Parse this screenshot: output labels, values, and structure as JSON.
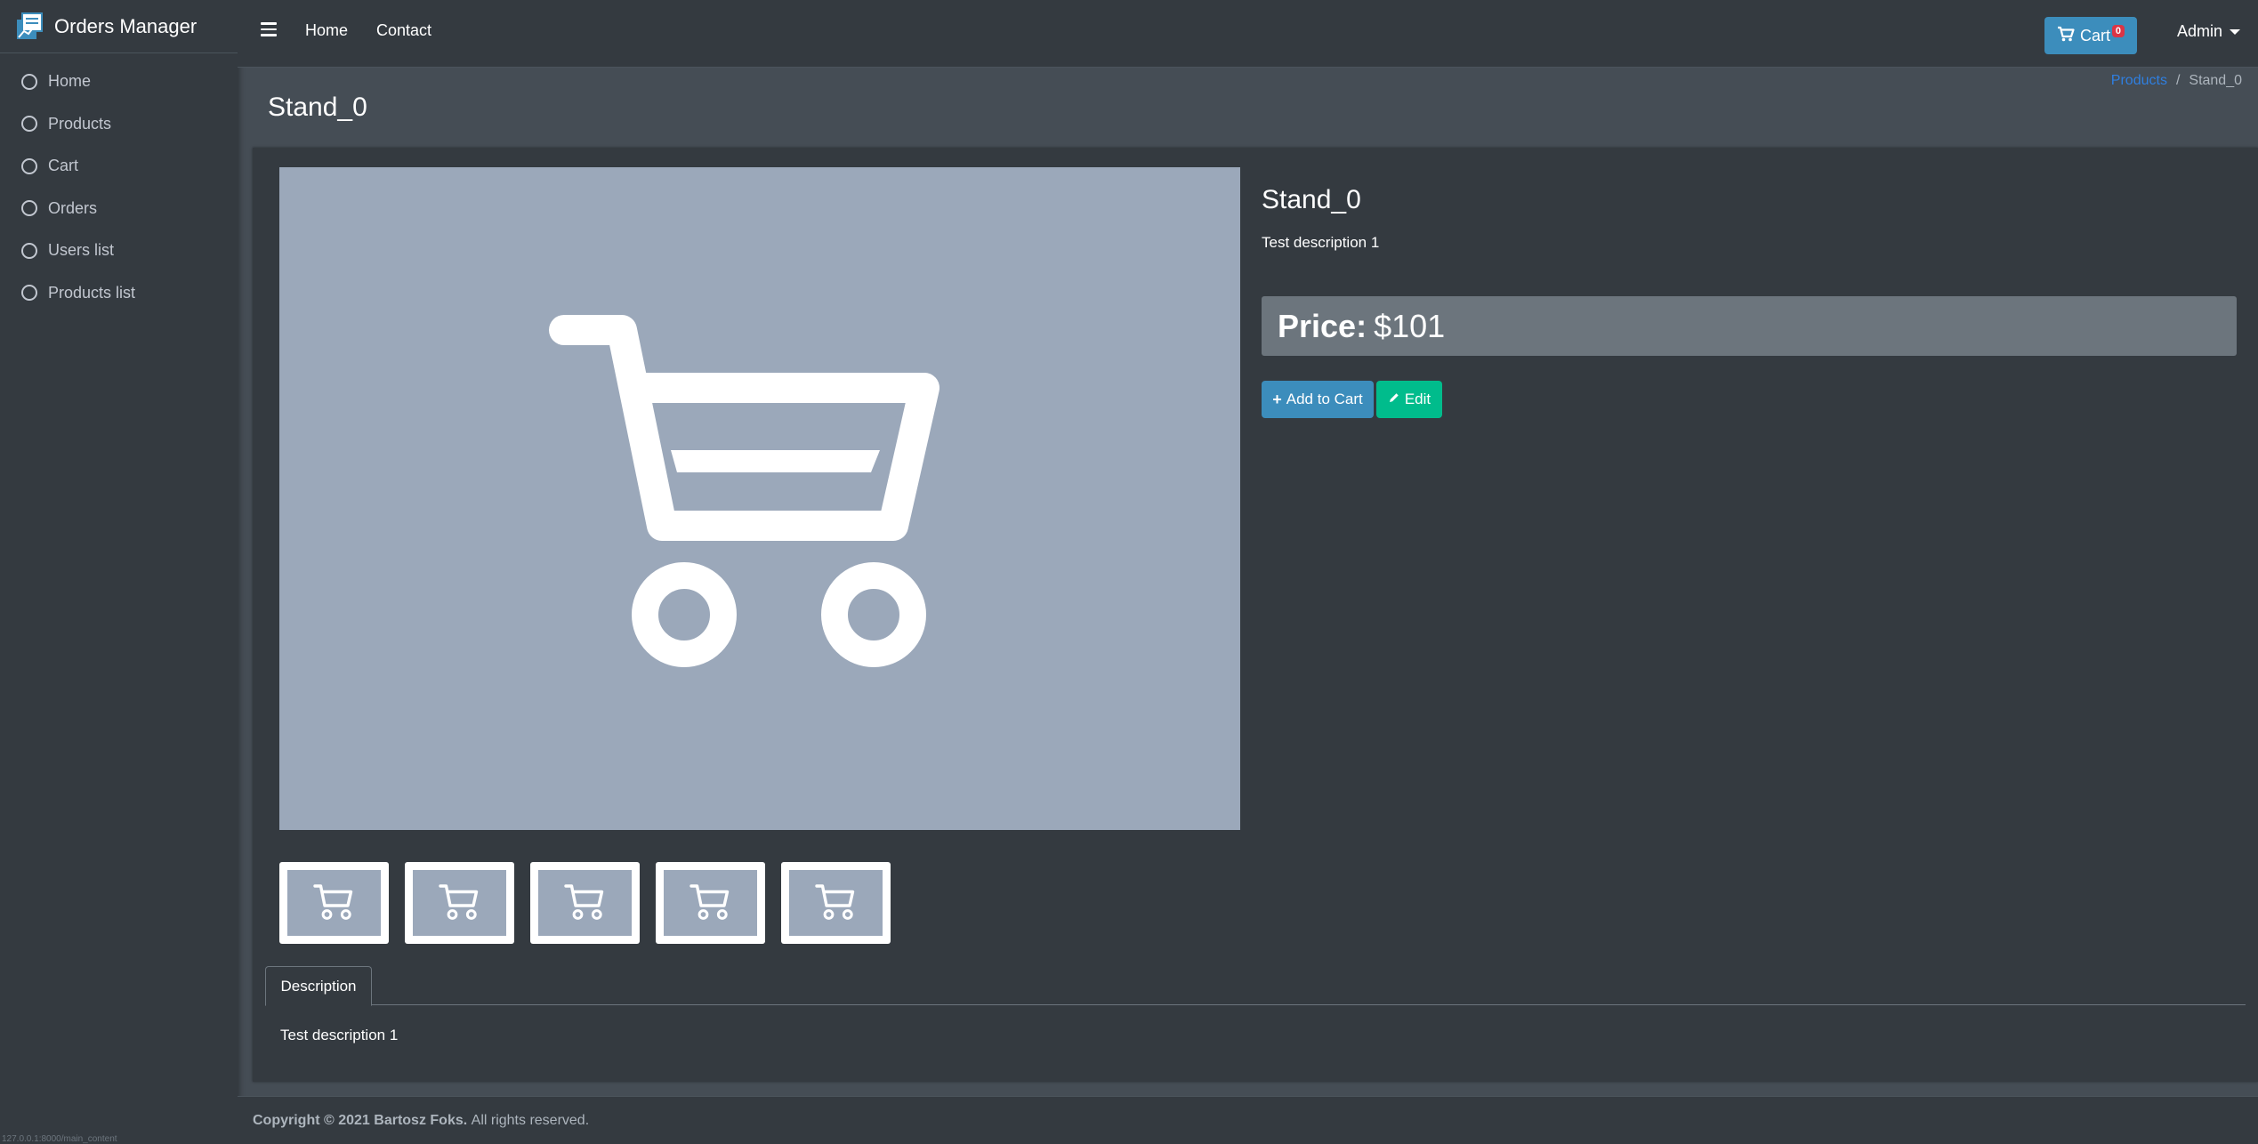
{
  "sidebar": {
    "brand": "Orders Manager",
    "items": [
      {
        "label": "Home"
      },
      {
        "label": "Products"
      },
      {
        "label": "Cart"
      },
      {
        "label": "Orders"
      },
      {
        "label": "Users list"
      },
      {
        "label": "Products list"
      }
    ],
    "status_url": "127.0.0.1:8000/main_content"
  },
  "topbar": {
    "links": [
      "Home",
      "Contact"
    ],
    "cart_label": "Cart",
    "cart_count": "0",
    "user_label": "Admin"
  },
  "header": {
    "title": "Stand_0",
    "breadcrumb": {
      "parent": "Products",
      "separator": "/",
      "current": "Stand_0"
    }
  },
  "product": {
    "name": "Stand_0",
    "short_description": "Test description 1",
    "price_label": "Price:",
    "price_value": "$101",
    "add_to_cart_label": "Add to Cart",
    "edit_label": "Edit",
    "thumbnail_count": 5
  },
  "tabs": {
    "description_label": "Description",
    "description_text": "Test description 1"
  },
  "footer": {
    "copyright_bold": "Copyright © 2021 Bartosz Foks.",
    "copyright_rest": "All rights reserved."
  },
  "colors": {
    "sidebar_bg": "#343a40",
    "content_bg": "#454d55",
    "primary": "#3c8dbc",
    "success": "#00bc8c",
    "danger": "#dc3545",
    "image_placeholder": "#9ba8ba"
  }
}
